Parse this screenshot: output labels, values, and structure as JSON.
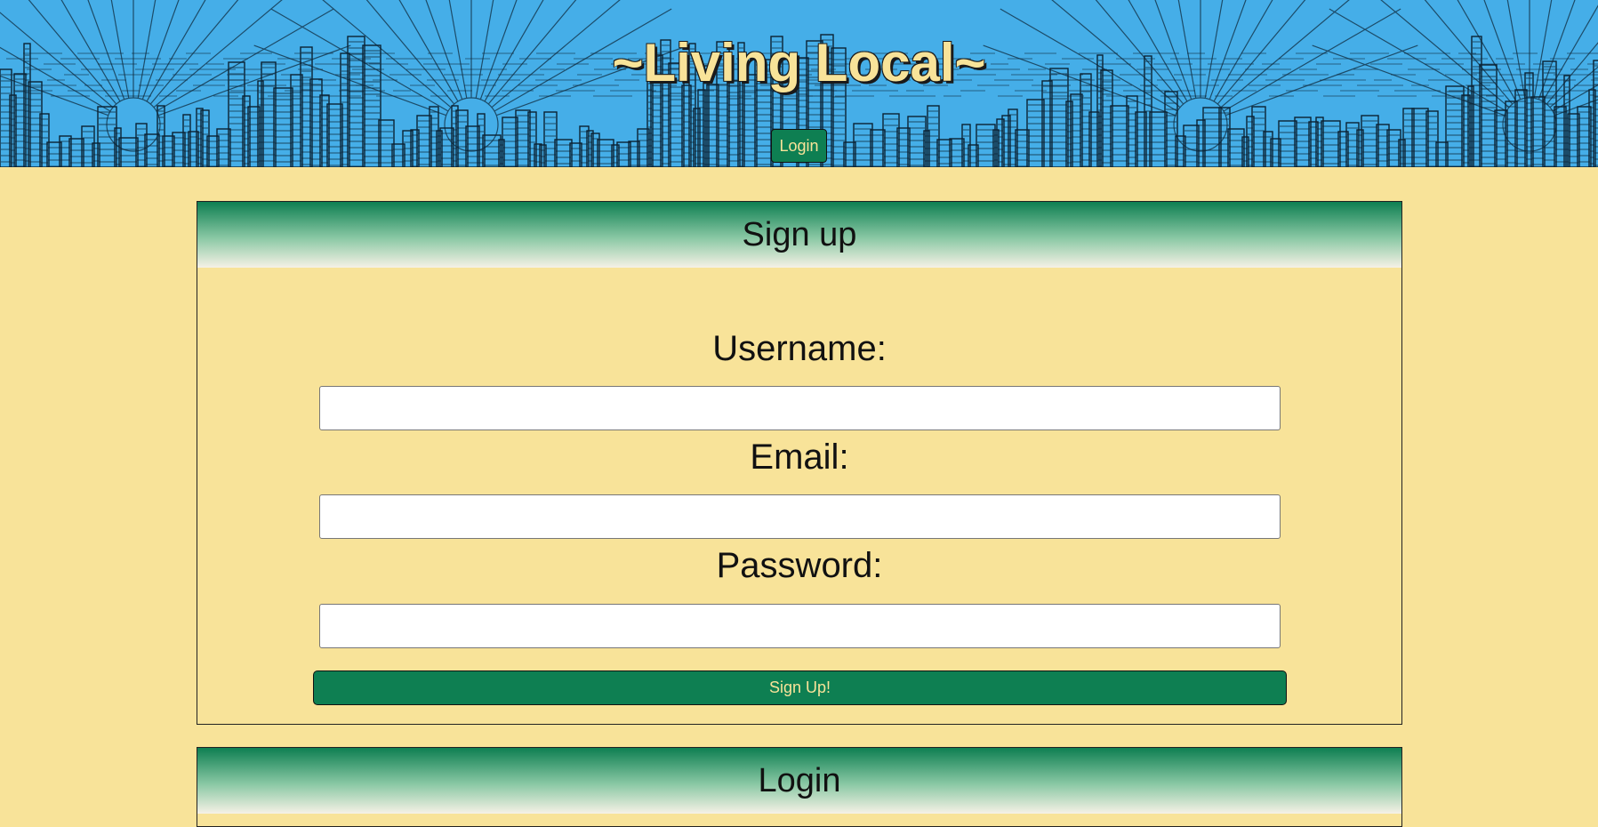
{
  "header": {
    "site_title": "~Living Local~",
    "login_button": "Login"
  },
  "signup": {
    "heading": "Sign up",
    "username_label": "Username:",
    "username_value": "",
    "email_label": "Email:",
    "email_value": "",
    "password_label": "Password:",
    "password_value": "",
    "submit_label": "Sign Up!"
  },
  "login": {
    "heading": "Login"
  },
  "colors": {
    "header_sky": "#45aee8",
    "page_background": "#f8e399",
    "accent_green": "#0e7f52",
    "title_text": "#f8e399"
  }
}
